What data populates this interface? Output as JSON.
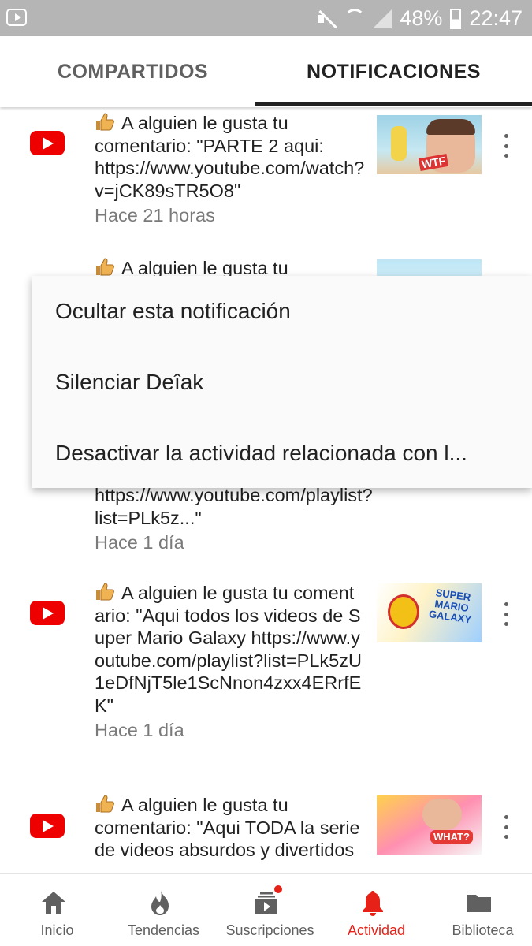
{
  "status_bar": {
    "battery": "48%",
    "time": "22:47"
  },
  "tabs": [
    {
      "label": "COMPARTIDOS",
      "active": false
    },
    {
      "label": "NOTIFICACIONES",
      "active": true
    }
  ],
  "notifications": [
    {
      "text": "A alguien le gusta tu comentario: \"PARTE 2 aqui: https://www.youtube.com/watch?v=jCK89sTR5O8\"",
      "time": "Hace 21 horas"
    },
    {
      "text": "A alguien le gusta tu",
      "time": ""
    },
    {
      "text": "https://www.youtube.com/playlist?list=PLk5z...\"",
      "time": "Hace 1 día"
    },
    {
      "text": "A alguien le gusta tu comentario: \"Aqui todos los videos de Super Mario Galaxy https://www.youtube.com/playlist?list=PLk5zU1eDfNjT5le1ScNnon4zxx4ERrfEK\"",
      "time": "Hace 1 día",
      "thumb_text": "SUPER MARIO GALAXY"
    },
    {
      "text": "A alguien le gusta tu comentario: \"Aqui TODA la serie de videos absurdos y divertidos",
      "time": "",
      "thumb_text": "WHAT?"
    }
  ],
  "thumb_1_text": "WTF",
  "menu": {
    "items": [
      "Ocultar esta notificación",
      "Silenciar Deîak",
      "Desactivar la actividad relacionada con l..."
    ]
  },
  "bottom_nav": {
    "items": [
      {
        "label": "Inicio",
        "icon": "home-icon"
      },
      {
        "label": "Tendencias",
        "icon": "fire-icon"
      },
      {
        "label": "Suscripciones",
        "icon": "subscriptions-icon"
      },
      {
        "label": "Actividad",
        "icon": "bell-icon",
        "active": true
      },
      {
        "label": "Biblioteca",
        "icon": "folder-icon"
      }
    ]
  },
  "colors": {
    "accent": "#e62117",
    "youtube_red": "#ee0000",
    "status_bar": "#b5b5b5"
  }
}
